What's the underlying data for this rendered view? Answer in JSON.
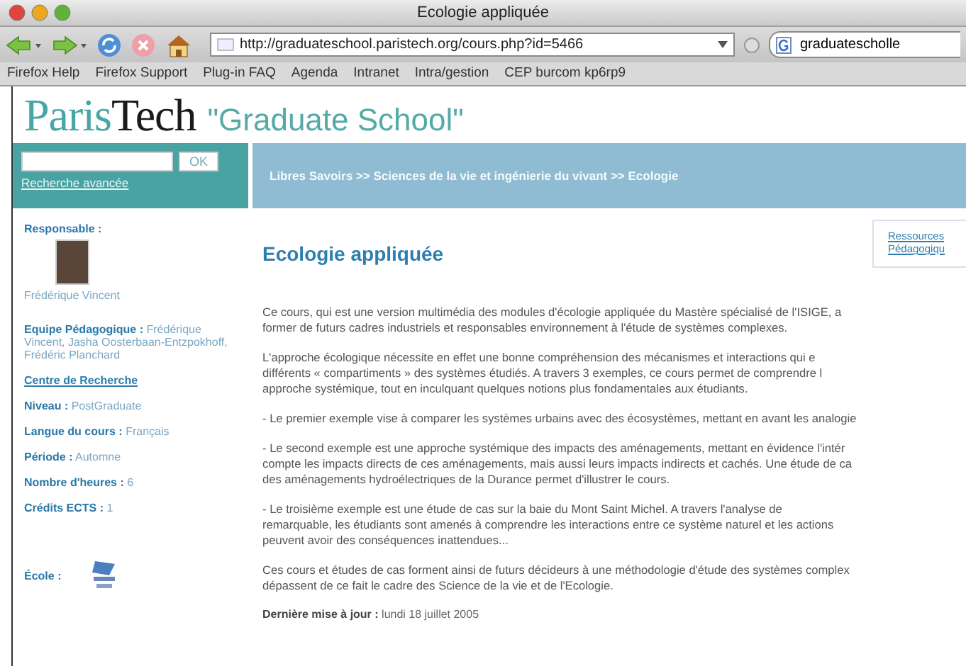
{
  "window": {
    "title": "Ecologie appliquée"
  },
  "toolbar": {
    "url": "http://graduateschool.paristech.org/cours.php?id=5466",
    "search_value": "graduatescholle"
  },
  "bookmarks": [
    "Firefox Help",
    "Firefox Support",
    "Plug-in FAQ",
    "Agenda",
    "Intranet",
    "Intra/gestion",
    "CEP burcom kp6rp9"
  ],
  "site": {
    "logo_light": "Paris",
    "logo_dark": "Tech",
    "tagline": "\"Graduate School\""
  },
  "search": {
    "button": "OK",
    "advanced_link": "Recherche avancée"
  },
  "breadcrumb": "Libres Savoirs >> Sciences de la vie et ingénierie du vivant >> Ecologie",
  "sidebar": {
    "items": [
      {
        "kind": "photo",
        "label": "Responsable :",
        "value": "Frédérique Vincent"
      },
      {
        "kind": "field",
        "label": "Equipe Pédagogique :",
        "value": "Frédérique Vincent, Jasha Oosterbaan-Entzpokhoff, Frédéric Planchard"
      },
      {
        "kind": "link",
        "label": "Centre de Recherche"
      },
      {
        "kind": "field",
        "label": "Niveau :",
        "value": "PostGraduate"
      },
      {
        "kind": "field",
        "label": "Langue du cours :",
        "value": "Français"
      },
      {
        "kind": "field",
        "label": "Période :",
        "value": "Automne"
      },
      {
        "kind": "field",
        "label": "Nombre d'heures :",
        "value": "6"
      },
      {
        "kind": "field",
        "label": "Crédits ECTS :",
        "value": "1"
      },
      {
        "kind": "logo",
        "label": "École :"
      }
    ]
  },
  "main": {
    "title": "Ecologie appliquée",
    "resources_link": [
      "Ressources",
      "Pédagogiqu"
    ],
    "paragraphs": [
      {
        "lines": [
          "Ce cours, qui est une version multimédia des modules d'écologie appliquée du Mastère spécialisé de l'ISIGE, a",
          "former de futurs cadres industriels et responsables environnement à l'étude de systèmes complexes."
        ]
      },
      {
        "lines": [
          "L'approche écologique nécessite en effet une bonne compréhension des mécanismes et interactions qui e",
          "différents « compartiments » des systèmes étudiés. A travers 3 exemples, ce cours permet de comprendre l",
          "approche systémique, tout en inculquant quelques notions plus fondamentales aux étudiants."
        ]
      },
      {
        "lines": [
          "- Le premier exemple vise à comparer les systèmes urbains avec des écosystèmes, mettant en avant les analogie"
        ]
      },
      {
        "lines": [
          "- Le second exemple est une approche systémique des impacts des aménagements, mettant en évidence l'intér",
          "compte les impacts directs de ces aménagements, mais aussi leurs impacts indirects et cachés. Une étude de ca",
          "des aménagements hydroélectriques de la Durance permet d'illustrer le cours."
        ]
      },
      {
        "lines": [
          "- Le troisième exemple est une étude de cas sur la baie du Mont Saint Michel. A travers l'analyse de",
          "remarquable, les étudiants sont amenés à comprendre les interactions entre ce système naturel et les actions",
          "peuvent avoir des conséquences inattendues..."
        ]
      },
      {
        "lines": [
          "Ces cours et études de cas forment ainsi de futurs décideurs à une méthodologie d'étude des systèmes complex",
          "dépassent de ce fait le cadre des Science de la vie et de l'Ecologie."
        ]
      }
    ],
    "updated": {
      "label": "Dernière mise à jour :",
      "value": "lundi 18 juillet 2005"
    }
  }
}
